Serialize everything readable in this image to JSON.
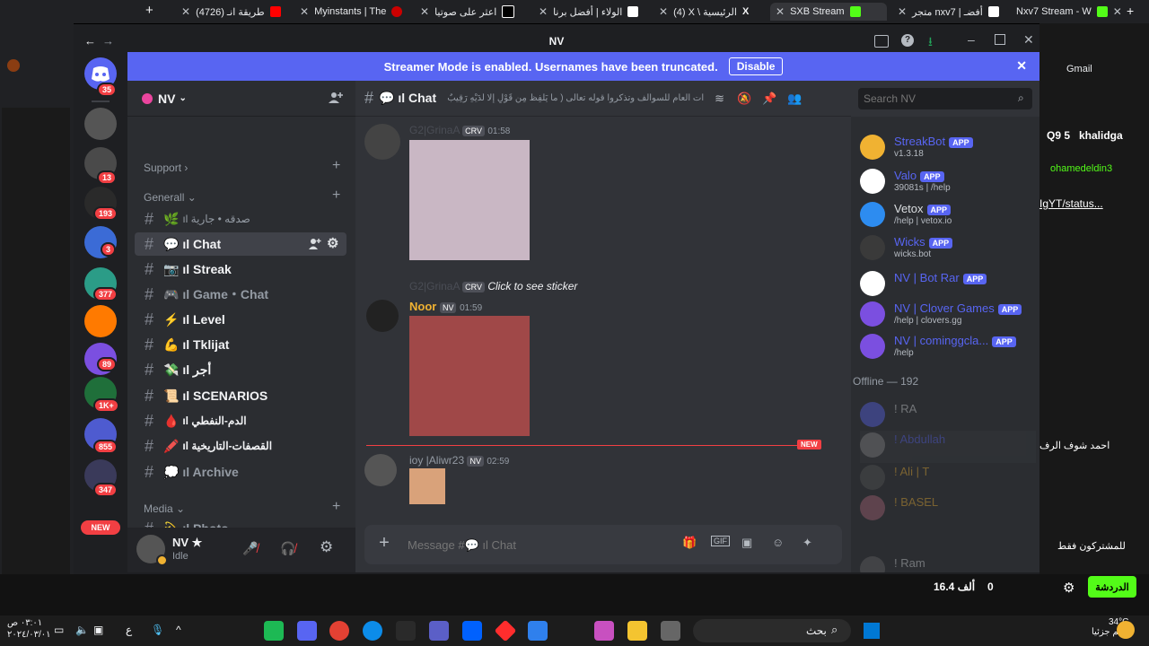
{
  "browser_tabs": [
    {
      "label": "(4726) طريقة انـ",
      "color": "#ff0000"
    },
    {
      "label": "Myinstants | The",
      "color": "#cc0000"
    },
    {
      "label": "اعثر على صوتيا",
      "color": "#000000"
    },
    {
      "label": "الولاء | أفضل برنا",
      "color": "#ffffff"
    },
    {
      "label": "(4) X \\ الرئيسية",
      "color": "#ffffff"
    },
    {
      "label": "SXB Stream",
      "color": "#53fc18"
    },
    {
      "label": "متجر nxv7 | أفضـ",
      "color": "#ffffff"
    },
    {
      "label": "Nxv7 Stream - W",
      "color": "#53fc18"
    }
  ],
  "window": {
    "title": "NV"
  },
  "streamer": {
    "message": "Streamer Mode is enabled. Usernames have been truncated.",
    "disable_label": "Disable"
  },
  "guild_badges": [
    "35",
    "13",
    "193",
    "3",
    "377",
    "89",
    "1K+",
    "855",
    "347"
  ],
  "guild_new": "NEW",
  "server": {
    "name": "NV"
  },
  "categories": {
    "support": "Support",
    "general": "Generall",
    "media": "Media"
  },
  "channels": [
    {
      "emoji": "🌿",
      "name": "ıl صدقه • جارية"
    },
    {
      "emoji": "💬",
      "name": "ıl Chat"
    },
    {
      "emoji": "📷",
      "name": "ıl Streak"
    },
    {
      "emoji": "🎮",
      "name": "ıl Game・Chat"
    },
    {
      "emoji": "⚡",
      "name": "ıl Level"
    },
    {
      "emoji": "💪",
      "name": "ıl Tklijat"
    },
    {
      "emoji": "💸",
      "name": "ıl أجر"
    },
    {
      "emoji": "📜",
      "name": "ıl SCENARIOS"
    },
    {
      "emoji": "🩸",
      "name": "ıl الدم-النفطي"
    },
    {
      "emoji": "🖍️",
      "name": "ıl القصفات-التاريخية"
    },
    {
      "emoji": "💭",
      "name": "ıl Archive"
    },
    {
      "emoji": "💫",
      "name": "ıl Photo"
    }
  ],
  "user": {
    "name": "NV ★",
    "status": "Idle"
  },
  "chat": {
    "channel": "ıl Chat",
    "topic": "ات العام للسوالف وتذكروا قوله تعالى ( ما يَلْفِظُ مِن قَوْلٍ إِلَّا لَدَيْهِ رَقِيبٌ عَتِيدٌ )",
    "messages": [
      {
        "user": "G2|GrinaA",
        "tag": "CRV",
        "time": "01:58"
      },
      {
        "reply_user": "G2|GrinaA",
        "reply_tag": "CRV",
        "reply_text": "Click to see sticker",
        "user": "Noor",
        "tag": "NV",
        "time": "01:59"
      },
      {
        "user": "ioy |Aliwr23",
        "tag": "NV",
        "time": "02:59"
      }
    ],
    "new_label": "NEW",
    "placeholder": "Message #💬 ıl Chat"
  },
  "search": {
    "placeholder": "Search NV"
  },
  "members": [
    {
      "name": "StreakBot",
      "sub": "v1.3.18",
      "badge": "APP",
      "color": "#f0b232"
    },
    {
      "name": "Valo",
      "sub": "39081s | /help",
      "badge": "APP",
      "color": "#ffffff"
    },
    {
      "name": "Vetox",
      "sub": "/help | vetox.io",
      "badge": "APP",
      "color": "#2d8cf0"
    },
    {
      "name": "Wicks",
      "sub": "wicks.bot",
      "badge": "APP",
      "color": "#3a3a3a"
    },
    {
      "name": "NV | Bot Rar",
      "sub": "",
      "badge": "APP",
      "color": "#ffffff"
    },
    {
      "name": "NV | Clover Games",
      "sub": "/help | clovers.gg",
      "badge": "APP",
      "color": "#7b4fe0"
    },
    {
      "name": "NV | cominggcla...",
      "sub": "/help",
      "badge": "APP",
      "color": "#7b4fe0"
    }
  ],
  "offline": {
    "header": "Offline — 192",
    "members": [
      "! RA",
      "! Abdullah",
      "! Ali | T",
      "! BASEL",
      "! Ram"
    ]
  },
  "taskbar": {
    "search": "بحث",
    "weather_temp": "34°C",
    "weather_desc": "غالم جزئيا",
    "lang": "ع",
    "time": "٠٣:٠١ ص",
    "date": "٢٠٢٤/٠٣/٠١",
    "page_right_btn": "الدردشة",
    "viewers": "16.4 ألف",
    "zero": "0",
    "sidebar_right_1": "Q9 5",
    "sidebar_right_2": "khalidga",
    "sidebar_right_3": "ohamedeldin3",
    "sidebar_right_4": "IgYT/status...",
    "gmail": "Gmail",
    "subscribers_only": "للمشتركون فقط",
    "comment_fragment": "احمد شوف الرف"
  }
}
